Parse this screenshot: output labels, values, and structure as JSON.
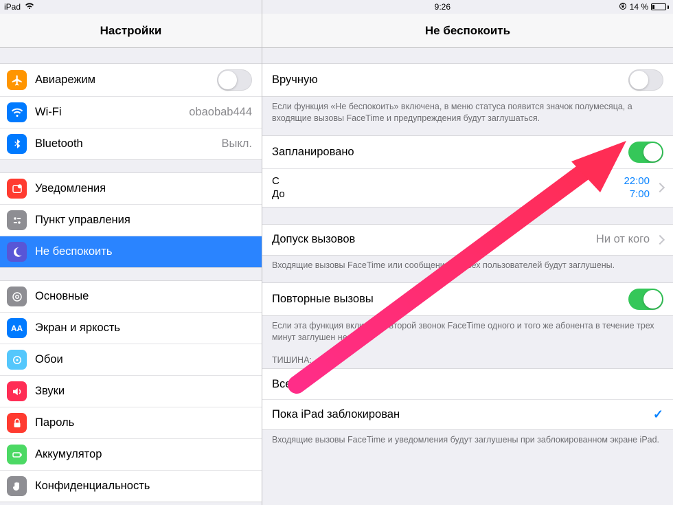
{
  "status_bar": {
    "device": "iPad",
    "time": "9:26",
    "orientation_lock": "⊕",
    "battery_percent": "14 %"
  },
  "sidebar": {
    "title": "Настройки",
    "group1": [
      {
        "name": "airplane",
        "label": "Авиарежим",
        "toggle": false,
        "color": "#ff9500"
      },
      {
        "name": "wifi",
        "label": "Wi-Fi",
        "value": "obaobab444",
        "color": "#007aff"
      },
      {
        "name": "bluetooth",
        "label": "Bluetooth",
        "value": "Выкл.",
        "color": "#007aff"
      }
    ],
    "group2": [
      {
        "name": "notifications",
        "label": "Уведомления",
        "color": "#ff3b30"
      },
      {
        "name": "control-center",
        "label": "Пункт управления",
        "color": "#8e8e93"
      },
      {
        "name": "dnd",
        "label": "Не беспокоить",
        "color": "#5856d6",
        "selected": true
      }
    ],
    "group3": [
      {
        "name": "general",
        "label": "Основные",
        "color": "#8e8e93"
      },
      {
        "name": "display",
        "label": "Экран и яркость",
        "color": "#007aff",
        "iconText": "AA"
      },
      {
        "name": "wallpaper",
        "label": "Обои",
        "color": "#54c7fc"
      },
      {
        "name": "sounds",
        "label": "Звуки",
        "color": "#ff2d55"
      },
      {
        "name": "passcode",
        "label": "Пароль",
        "color": "#ff3b30"
      },
      {
        "name": "battery",
        "label": "Аккумулятор",
        "color": "#4cd964"
      },
      {
        "name": "privacy",
        "label": "Конфиденциальность",
        "color": "#8e8e93"
      }
    ]
  },
  "detail": {
    "title": "Не беспокоить",
    "manual": {
      "label": "Вручную",
      "on": false
    },
    "manual_foot": "Если функция «Не беспокоить» включена, в меню статуса появится значок полумесяца, а входящие вызовы FaceTime и предупреждения будут заглушаться.",
    "scheduled": {
      "label": "Запланировано",
      "on": true
    },
    "schedule_from_label": "С",
    "schedule_to_label": "До",
    "schedule_from_value": "22:00",
    "schedule_to_value": "7:00",
    "allow_calls": {
      "label": "Допуск вызовов",
      "value": "Ни от кого"
    },
    "allow_calls_foot": "Входящие вызовы FaceTime или сообщения от всех пользователей будут заглушены.",
    "repeated": {
      "label": "Повторные вызовы",
      "on": true
    },
    "repeated_foot": "Если эта функция включена, второй звонок FaceTime одного и того же абонента в течение трех минут заглушен не будет.",
    "silence_header": "ТИШИНА:",
    "silence_opt1": "Всегда",
    "silence_opt2": "Пока iPad заблокирован",
    "silence_foot": "Входящие вызовы FaceTime и уведомления будут заглушены при заблокированном экране iPad."
  }
}
